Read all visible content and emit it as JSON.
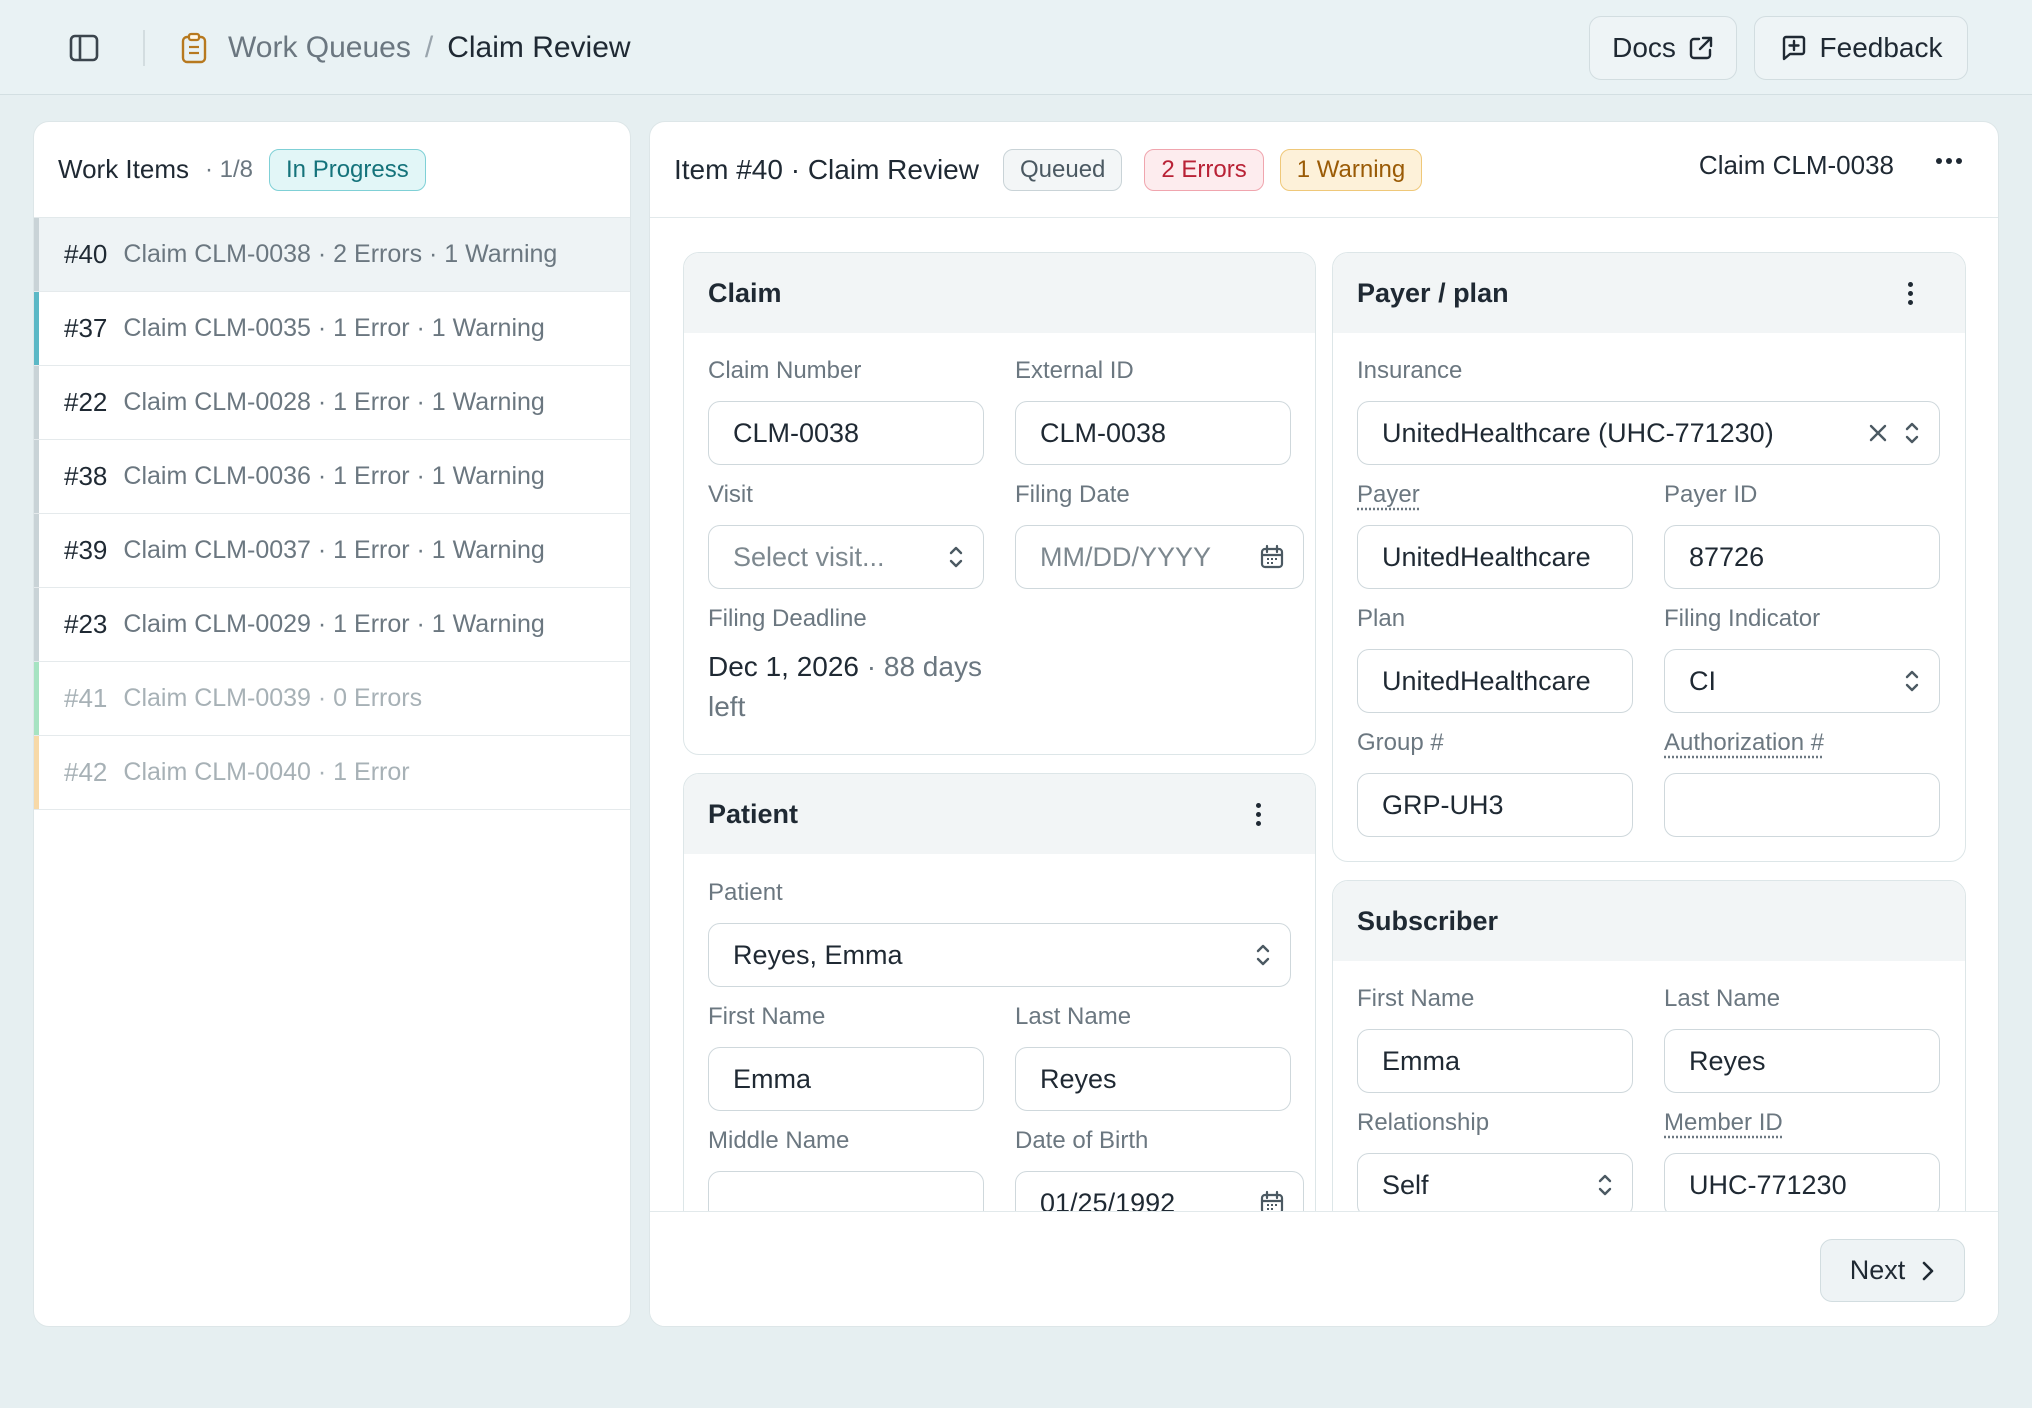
{
  "header": {
    "breadcrumb_parent": "Work Queues",
    "breadcrumb_sep": "/",
    "breadcrumb_current": "Claim Review",
    "docs_label": "Docs",
    "feedback_label": "Feedback"
  },
  "work_items": {
    "title": "Work Items",
    "count": "· 1/8",
    "status": "In Progress",
    "items": [
      {
        "num": "#40",
        "desc": "Claim CLM-0038 · 2 Errors · 1 Warning",
        "color": "#c9d3d7"
      },
      {
        "num": "#37",
        "desc": "Claim CLM-0035 · 1 Error · 1 Warning",
        "color": "#5bb8c6"
      },
      {
        "num": "#22",
        "desc": "Claim CLM-0028 · 1 Error · 1 Warning",
        "color": "#c9d3d7"
      },
      {
        "num": "#38",
        "desc": "Claim CLM-0036 · 1 Error · 1 Warning",
        "color": "#c9d3d7"
      },
      {
        "num": "#39",
        "desc": "Claim CLM-0037 · 1 Error · 1 Warning",
        "color": "#c9d3d7"
      },
      {
        "num": "#23",
        "desc": "Claim CLM-0029 · 1 Error · 1 Warning",
        "color": "#c9d3d7"
      },
      {
        "num": "#41",
        "desc": "Claim CLM-0039 · 0 Errors",
        "color": "#a6e3c2"
      },
      {
        "num": "#42",
        "desc": "Claim CLM-0040 · 1 Error",
        "color": "#f7d9a8"
      }
    ]
  },
  "item_header": {
    "title": "Item #40 · Claim Review",
    "status": "Queued",
    "errors": "2 Errors",
    "warnings": "1 Warning",
    "claim_ref": "Claim CLM-0038"
  },
  "claim": {
    "title": "Claim",
    "claim_number_label": "Claim Number",
    "claim_number": "CLM-0038",
    "external_id_label": "External ID",
    "external_id": "CLM-0038",
    "visit_label": "Visit",
    "visit_placeholder": "Select visit...",
    "filing_date_label": "Filing Date",
    "filing_date_placeholder": "MM/DD/YYYY",
    "filing_deadline_label": "Filing Deadline",
    "filing_deadline": "Dec 1, 2026",
    "days_left": "· 88 days",
    "days_left_2": "left"
  },
  "patient": {
    "title": "Patient",
    "patient_label": "Patient",
    "patient_value": "Reyes, Emma",
    "first_name_label": "First Name",
    "first_name": "Emma",
    "last_name_label": "Last Name",
    "last_name": "Reyes",
    "middle_name_label": "Middle Name",
    "middle_name": "",
    "dob_label": "Date of Birth",
    "dob": "01/25/1992"
  },
  "payer": {
    "title": "Payer / plan",
    "insurance_label": "Insurance",
    "insurance": "UnitedHealthcare (UHC-771230)",
    "payer_label": "Payer",
    "payer": "UnitedHealthcare",
    "payer_id_label": "Payer ID",
    "payer_id": "87726",
    "plan_label": "Plan",
    "plan": "UnitedHealthcare",
    "filing_indicator_label": "Filing Indicator",
    "filing_indicator": "CI",
    "group_label": "Group #",
    "group": "GRP-UH3",
    "auth_label": "Authorization #",
    "auth": ""
  },
  "subscriber": {
    "title": "Subscriber",
    "first_name_label": "First Name",
    "first_name": "Emma",
    "last_name_label": "Last Name",
    "last_name": "Reyes",
    "relationship_label": "Relationship",
    "relationship": "Self",
    "member_id_label": "Member ID",
    "member_id": "UHC-771230"
  },
  "footer": {
    "next_label": "Next"
  }
}
